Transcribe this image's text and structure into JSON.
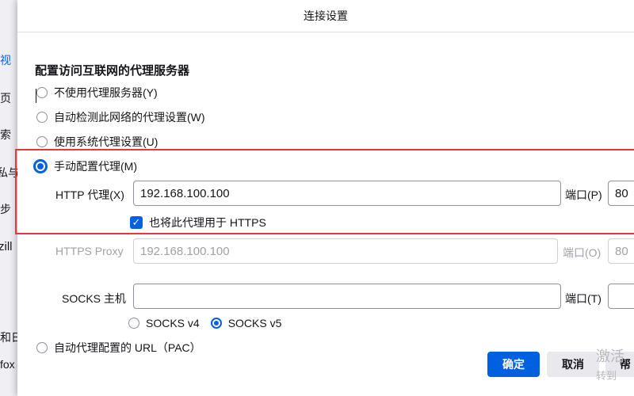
{
  "background_page": {
    "fragments": [
      "视",
      "页",
      "索",
      "私与",
      "步",
      "zill",
      "和日",
      "fox"
    ]
  },
  "dialog": {
    "title": "连接设置",
    "section_title": "配置访问互联网的代理服务器",
    "options": {
      "no_proxy": "不使用代理服务器(Y)",
      "auto_detect": "自动检测此网络的代理设置(W)",
      "system_proxy": "使用系统代理设置(U)",
      "manual_proxy": "手动配置代理(M)",
      "pac_url": "自动代理配置的 URL（PAC）"
    },
    "selected_option": "manual_proxy",
    "http": {
      "label": "HTTP 代理(X)",
      "value": "192.168.100.100",
      "port_label": "端口(P)",
      "port_value": "80"
    },
    "use_for_https": {
      "label": "也将此代理用于 HTTPS",
      "checked": true
    },
    "https": {
      "label": "HTTPS Proxy",
      "value": "192.168.100.100",
      "port_label": "端口(O)",
      "port_value": "80"
    },
    "socks": {
      "label": "SOCKS 主机",
      "value": "",
      "port_label": "端口(T)",
      "port_value": "",
      "v4_label": "SOCKS v4",
      "v5_label": "SOCKS v5",
      "selected_version": "v5"
    },
    "buttons": {
      "ok": "确定",
      "cancel": "取消",
      "help": "帮"
    }
  },
  "watermark": {
    "line1": "激活",
    "line2": "转到"
  },
  "colors": {
    "accent": "#0061e0",
    "highlight_border": "#e8363a"
  }
}
